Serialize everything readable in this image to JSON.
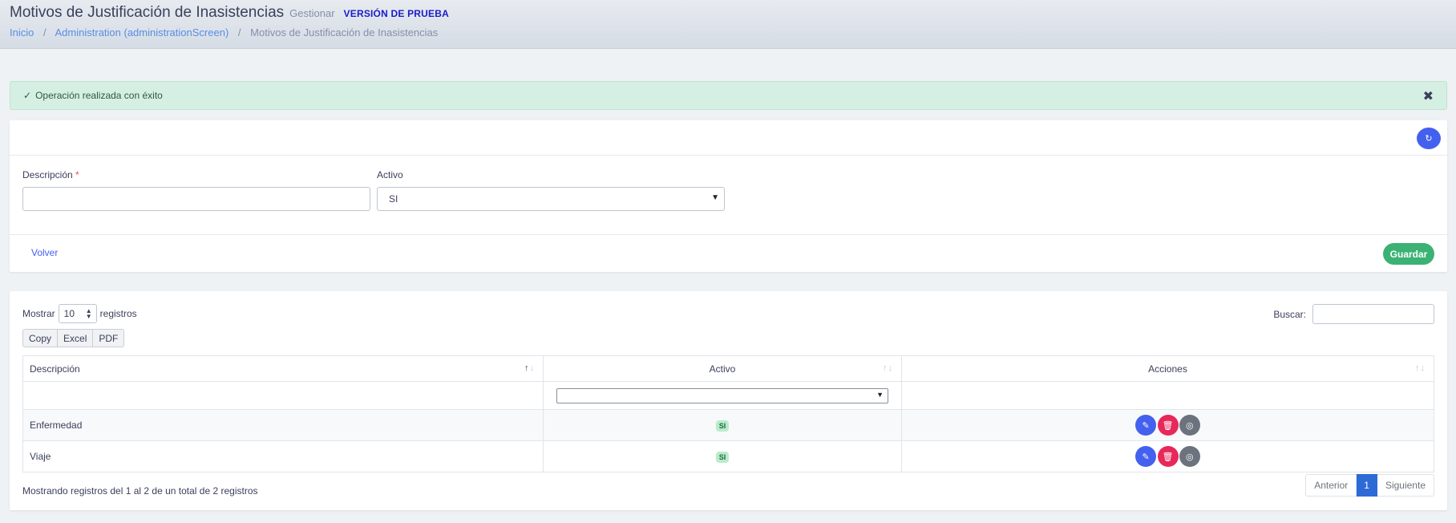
{
  "header": {
    "title": "Motivos de Justificación de Inasistencias",
    "subtitle": "Gestionar",
    "trial_badge": "VERSIÓN DE PRUEBA",
    "breadcrumb": {
      "home": "Inicio",
      "section": "Administration (administrationScreen)",
      "current": "Motivos de Justificación de Inasistencias",
      "separator": "/"
    }
  },
  "alert": {
    "message": "Operación realizada con éxito",
    "check_icon": "✓",
    "close_icon": "✖"
  },
  "form": {
    "descripcion_label": "Descripción",
    "required_mark": "*",
    "descripcion_value": "",
    "activo_label": "Activo",
    "activo_value": "SI",
    "volver_label": "Volver",
    "guardar_label": "Guardar",
    "refresh_icon": "↻"
  },
  "table": {
    "show_label": "Mostrar",
    "page_length": "10",
    "records_label": "registros",
    "search_label": "Buscar:",
    "search_value": "",
    "export_buttons": [
      "Copy",
      "Excel",
      "PDF"
    ],
    "columns": [
      "Descripción",
      "Activo",
      "Acciones"
    ],
    "rows": [
      {
        "descripcion": "Enfermedad",
        "activo": "SI"
      },
      {
        "descripcion": "Viaje",
        "activo": "SI"
      }
    ],
    "info": "Mostrando registros del 1 al 2 de un total de 2 registros",
    "pagination": {
      "previous": "Anterior",
      "current": "1",
      "next": "Siguiente"
    }
  },
  "colors": {
    "primary": "#4361ee",
    "success": "#3bb273",
    "danger": "#e7285a",
    "secondary": "#6c727e",
    "alert_bg": "#d6efe3",
    "badge_text": "#1b1bc9"
  }
}
